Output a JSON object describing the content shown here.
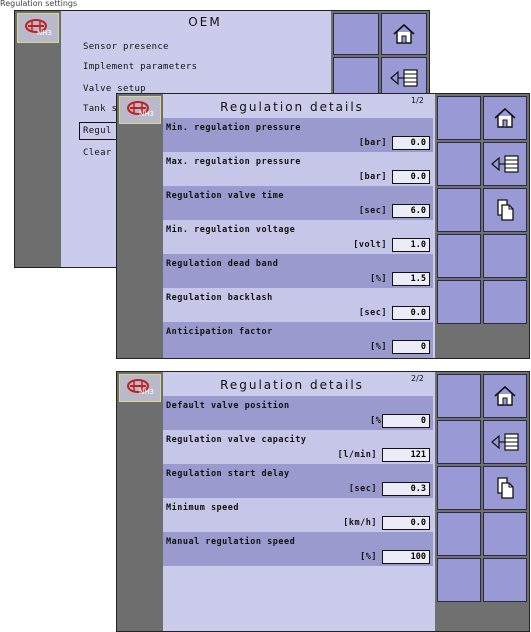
{
  "header_fragment": "Regulation settings",
  "oem_screen": {
    "title": "OEM",
    "menu_items": [
      "Sensor presence",
      "Implement parameters",
      "Valve setup",
      "Tank s",
      "Regul",
      "Clear"
    ]
  },
  "logo_label": "NH3",
  "page1": {
    "title": "Regulation details",
    "page": "1/2",
    "rows": [
      {
        "label": "Min. regulation pressure",
        "unit": "[bar]",
        "value": "0.0"
      },
      {
        "label": "Max. regulation pressure",
        "unit": "[bar]",
        "value": "0.0"
      },
      {
        "label": "Regulation valve time",
        "unit": "[sec]",
        "value": "6.0"
      },
      {
        "label": "Min. regulation voltage",
        "unit": "[volt]",
        "value": "1.0"
      },
      {
        "label": "Regulation dead band",
        "unit": "[%]",
        "value": "1.5"
      },
      {
        "label": "Regulation backlash",
        "unit": "[sec]",
        "value": "0.0"
      },
      {
        "label": "Anticipation factor",
        "unit": "[%]",
        "value": "0"
      }
    ]
  },
  "page2": {
    "title": "Regulation details",
    "page": "2/2",
    "rows": [
      {
        "label": "Default valve position",
        "unit": "[%]",
        "value": "0"
      },
      {
        "label": "Regulation valve capacity",
        "unit": "[l/min]",
        "value": "121"
      },
      {
        "label": "Regulation start delay",
        "unit": "[sec]",
        "value": "0.3"
      },
      {
        "label": "Minimum speed",
        "unit": "[km/h]",
        "value": "0.0"
      },
      {
        "label": "Manual regulation speed",
        "unit": "[%]",
        "value": "100"
      }
    ]
  },
  "icons": {
    "home": "home-icon",
    "back": "back-list-icon",
    "pages": "page-copy-icon"
  },
  "colors": {
    "screen_bg": "#cbcbeb",
    "row_dark": "#9a9acf",
    "button": "#9999d6",
    "panel_gray": "#707070"
  }
}
